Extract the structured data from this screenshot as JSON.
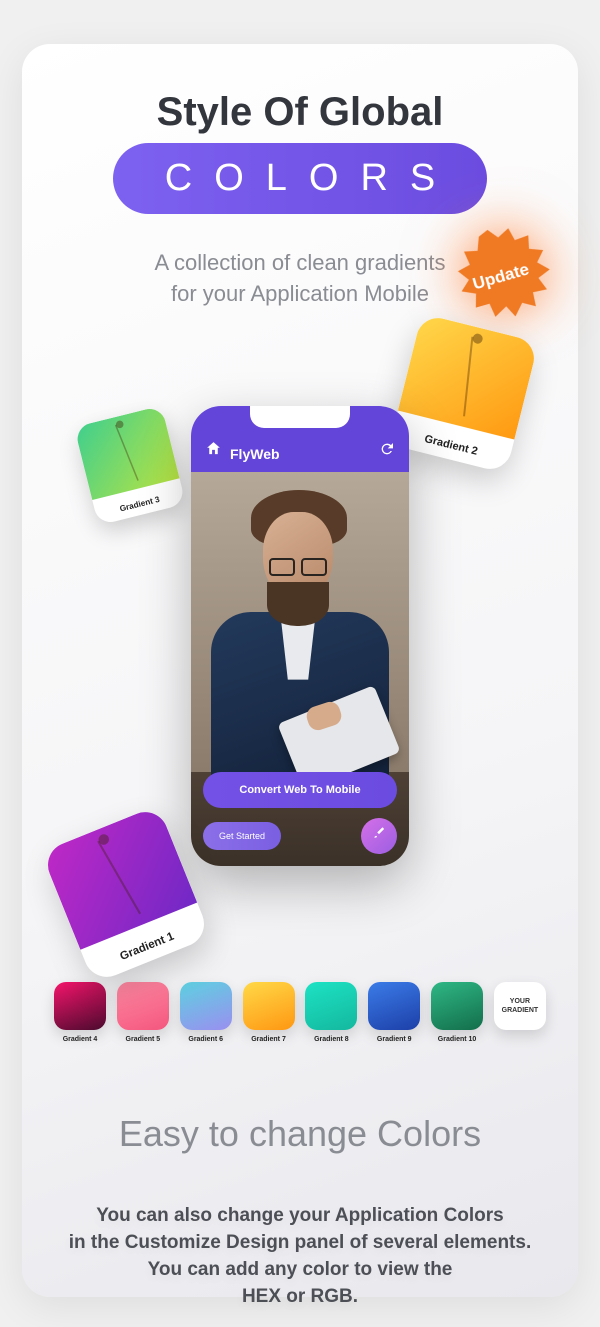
{
  "header": {
    "title_line1": "Style Of Global",
    "title_pill": "COLORS",
    "subtitle_l1": "A collection of clean gradients",
    "subtitle_l2": "for your Application Mobile",
    "badge": "Update"
  },
  "swatches_big": {
    "s1": "Gradient 1",
    "s2": "Gradient 2",
    "s3": "Gradient 3"
  },
  "phone": {
    "app_name": "FlyWeb",
    "btn_primary": "Convert Web To Mobile",
    "btn_secondary": "Get Started"
  },
  "swatches_row": [
    {
      "label": "Gradient 4",
      "cls": "g4"
    },
    {
      "label": "Gradient 5",
      "cls": "g5"
    },
    {
      "label": "Gradient 6",
      "cls": "g6"
    },
    {
      "label": "Gradient 7",
      "cls": "g7"
    },
    {
      "label": "Gradient 8",
      "cls": "g8"
    },
    {
      "label": "Gradient 9",
      "cls": "g9"
    },
    {
      "label": "Gradient 10",
      "cls": "g10"
    }
  ],
  "swatch_custom": "YOUR GRADIENT",
  "section2": {
    "heading": "Easy to change Colors",
    "body_l1": "You can also change your Application Colors",
    "body_l2": "in the Customize Design panel of several elements.",
    "body_l3": "You can add any color to view the",
    "body_l4": "HEX or RGB."
  }
}
